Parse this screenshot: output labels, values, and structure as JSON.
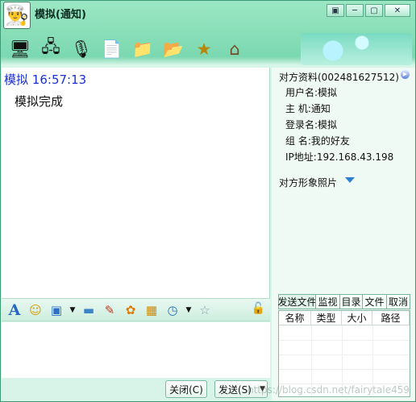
{
  "window": {
    "title": "模拟(通知)",
    "avatar_icon": "chef-avatar-icon",
    "controls": [
      "▣",
      "─",
      "▢",
      "✕"
    ]
  },
  "toolbar": {
    "icons": [
      {
        "name": "monitor-arrow-icon",
        "glyph": "🖥"
      },
      {
        "name": "remote-assist-icon",
        "glyph": "🖧"
      },
      {
        "name": "microphone-icon",
        "glyph": "🎙"
      },
      {
        "name": "send-file-icon",
        "glyph": "📄"
      },
      {
        "name": "folder-transfer-icon",
        "glyph": "📁"
      },
      {
        "name": "folder-icon",
        "glyph": "📂"
      },
      {
        "name": "star-hand-icon",
        "glyph": "★"
      },
      {
        "name": "home-icon",
        "glyph": "⌂"
      }
    ]
  },
  "chat": {
    "sender": "模拟",
    "time": "16:57:13",
    "message": "模拟完成"
  },
  "format_bar": {
    "icons": [
      {
        "name": "font-icon",
        "glyph": "A"
      },
      {
        "name": "emoji-icon",
        "glyph": "☺"
      },
      {
        "name": "screen-capture-icon",
        "glyph": "▣"
      },
      {
        "name": "picture-icon",
        "glyph": "▬"
      },
      {
        "name": "pencil-icon",
        "glyph": "✎"
      },
      {
        "name": "palette-icon",
        "glyph": "✿"
      },
      {
        "name": "calendar-icon",
        "glyph": "▦"
      },
      {
        "name": "clock-icon",
        "glyph": "◷"
      },
      {
        "name": "star-stamp-icon",
        "glyph": "☆"
      }
    ],
    "lock_icon": "🔓"
  },
  "buttons": {
    "close": "关闭(C)",
    "send": "发送(S)"
  },
  "side": {
    "info_title": "对方资料(002481627512)",
    "username": "用户名:模拟",
    "host": "主  机:通知",
    "login": "登录名:模拟",
    "group": "组  名:我的好友",
    "ip": "IP地址:192.168.43.198",
    "photo_title": "对方形象照片",
    "file_tabs": [
      "发送文件",
      "监视",
      "目录",
      "文件",
      "取消"
    ],
    "file_columns": [
      "名称",
      "类型",
      "大小",
      "路径"
    ]
  },
  "watermark": "https://blog.csdn.net/fairytale459"
}
